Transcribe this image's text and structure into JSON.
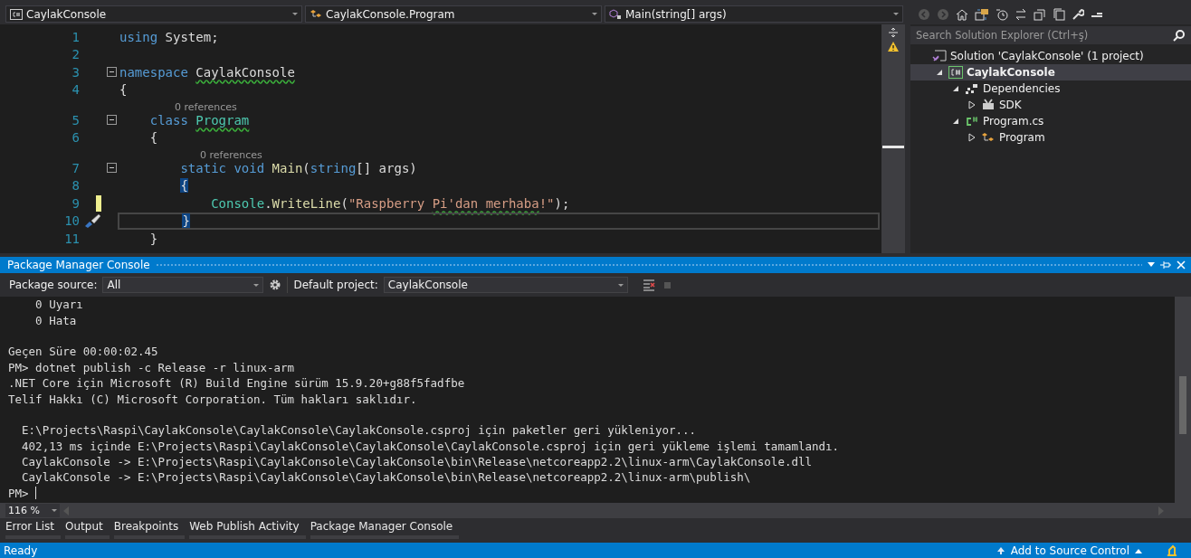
{
  "editor": {
    "nav": [
      {
        "kind": "project",
        "label": "CaylakConsole"
      },
      {
        "kind": "class",
        "label": "CaylakConsole.Program"
      },
      {
        "kind": "method",
        "label": "Main(string[] args)"
      }
    ],
    "lines": [
      {
        "number": "1",
        "fold": false,
        "modified": false,
        "current": false,
        "tokens": [
          {
            "kind": "kw",
            "text": "using "
          },
          {
            "kind": "plain",
            "text": "System;"
          }
        ]
      },
      {
        "number": "2",
        "fold": false,
        "modified": false,
        "current": false
      },
      {
        "number": "3",
        "fold": true,
        "modified": false,
        "current": false,
        "tokens": [
          {
            "kind": "kw",
            "text": "namespace "
          },
          {
            "kind": "plain",
            "text": "CaylakConsole",
            "squiggle": true
          }
        ]
      },
      {
        "number": "4",
        "fold": false,
        "modified": false,
        "current": false,
        "tokens": [
          {
            "kind": "plain",
            "text": "{"
          }
        ]
      },
      {
        "number": "5",
        "fold": true,
        "modified": false,
        "current": false,
        "lens": "0 references",
        "tokens": [
          {
            "kind": "kw",
            "text": "    class "
          },
          {
            "kind": "type",
            "text": "Program",
            "squiggle": true
          }
        ]
      },
      {
        "number": "6",
        "fold": false,
        "modified": false,
        "current": false,
        "tokens": [
          {
            "kind": "plain",
            "text": "    {"
          }
        ]
      },
      {
        "number": "7",
        "fold": true,
        "modified": false,
        "current": false,
        "lens": "0 references",
        "tokens": [
          {
            "kind": "kw",
            "text": "        static void "
          },
          {
            "kind": "method",
            "text": "Main"
          },
          {
            "kind": "plain",
            "text": "("
          },
          {
            "kind": "kw",
            "text": "string"
          },
          {
            "kind": "plain",
            "text": "[] args)"
          }
        ]
      },
      {
        "number": "8",
        "fold": false,
        "modified": false,
        "current": false,
        "tokens": [
          {
            "kind": "brace",
            "text": "        {"
          }
        ]
      },
      {
        "number": "9",
        "fold": false,
        "modified": true,
        "current": false,
        "tokens": [
          {
            "kind": "type",
            "text": "            Console"
          },
          {
            "kind": "plain",
            "text": "."
          },
          {
            "kind": "method",
            "text": "WriteLine"
          },
          {
            "kind": "plain",
            "text": "("
          },
          {
            "kind": "string",
            "text": "\"Raspberry "
          },
          {
            "kind": "string",
            "text": "Pi'dan merhaba",
            "squiggle": true
          },
          {
            "kind": "string",
            "text": "!\""
          },
          {
            "kind": "plain",
            "text": ");"
          }
        ]
      },
      {
        "number": "10",
        "fold": false,
        "modified": false,
        "current": true,
        "tokens": [
          {
            "kind": "brace",
            "text": "        }"
          }
        ]
      },
      {
        "number": "11",
        "fold": false,
        "modified": false,
        "current": false,
        "tokens": [
          {
            "kind": "plain",
            "text": "    }"
          }
        ]
      }
    ]
  },
  "solution_explorer": {
    "search": {
      "placeholder": "Search Solution Explorer (Ctrl+ş)"
    },
    "tree": [
      {
        "kind": "solution",
        "label": "Solution 'CaylakConsole' (1 project)",
        "selected": false,
        "children": [
          {
            "kind": "project",
            "label": "CaylakConsole",
            "selected": true,
            "expanded": true,
            "children": [
              {
                "kind": "dependencies",
                "label": "Dependencies",
                "selected": false,
                "expanded": true,
                "children": [
                  {
                    "kind": "sdk",
                    "label": "SDK",
                    "selected": false,
                    "expanded": false
                  }
                ]
              },
              {
                "kind": "csfile",
                "label": "Program.cs",
                "selected": false,
                "expanded": true,
                "children": [
                  {
                    "kind": "class",
                    "label": "Program",
                    "selected": false,
                    "expanded": false
                  }
                ]
              }
            ]
          }
        ]
      }
    ]
  },
  "console": {
    "title": "Package Manager Console",
    "source_label": "Package source:",
    "source": "All",
    "project_label": "Default project:",
    "project": "CaylakConsole",
    "lines": [
      {
        "kind": "text",
        "text": "    0 Uyarı"
      },
      {
        "kind": "text",
        "text": "    0 Hata"
      },
      {
        "kind": "blank"
      },
      {
        "kind": "text",
        "text": "Geçen Süre 00:00:02.45"
      },
      {
        "kind": "text",
        "text": "PM> dotnet publish -c Release -r linux-arm"
      },
      {
        "kind": "text",
        "text": ".NET Core için Microsoft (R) Build Engine sürüm 15.9.20+g88f5fadfbe"
      },
      {
        "kind": "text",
        "text": "Telif Hakkı (C) Microsoft Corporation. Tüm hakları saklıdır."
      },
      {
        "kind": "blank"
      },
      {
        "kind": "text",
        "text": "  E:\\Projects\\Raspi\\CaylakConsole\\CaylakConsole\\CaylakConsole.csproj için paketler geri yükleniyor..."
      },
      {
        "kind": "text",
        "text": "  402,13 ms içinde E:\\Projects\\Raspi\\CaylakConsole\\CaylakConsole\\CaylakConsole.csproj için geri yükleme işlemi tamamlandı."
      },
      {
        "kind": "text",
        "text": "  CaylakConsole -> E:\\Projects\\Raspi\\CaylakConsole\\CaylakConsole\\bin\\Release\\netcoreapp2.2\\linux-arm\\CaylakConsole.dll"
      },
      {
        "kind": "text",
        "text": "  CaylakConsole -> E:\\Projects\\Raspi\\CaylakConsole\\CaylakConsole\\bin\\Release\\netcoreapp2.2\\linux-arm\\publish\\"
      },
      {
        "kind": "prompt",
        "text": "PM> "
      }
    ],
    "zoom": "116 %"
  },
  "tool_tabs": [
    {
      "label": "Error List"
    },
    {
      "label": "Output"
    },
    {
      "label": "Breakpoints"
    },
    {
      "label": "Web Publish Activity"
    },
    {
      "label": "Package Manager Console"
    }
  ],
  "status_bar": {
    "state": "Ready",
    "source_control": "Add to Source Control"
  }
}
